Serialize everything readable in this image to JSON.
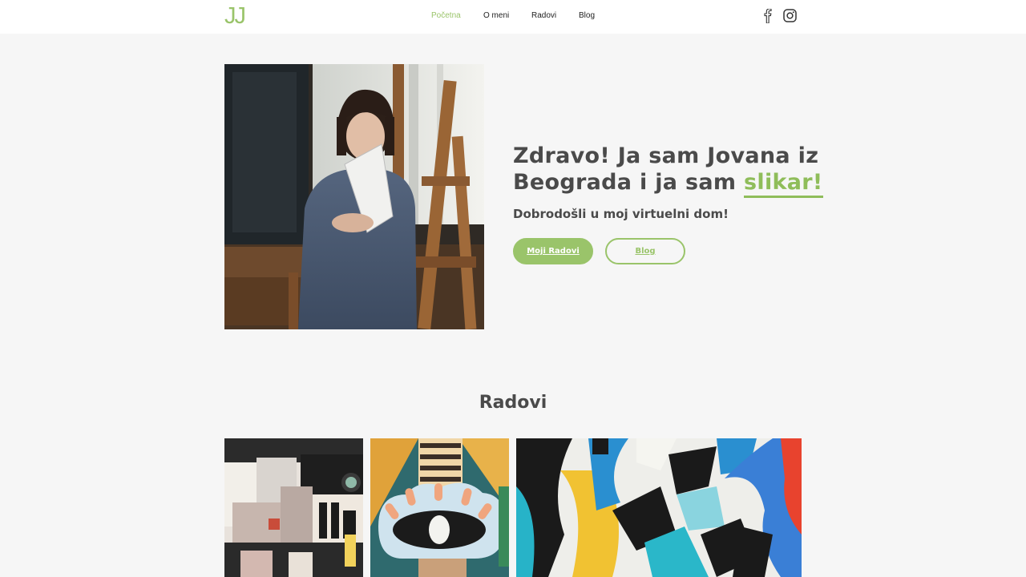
{
  "header": {
    "logo": "JJ",
    "nav": [
      {
        "label": "Početna",
        "active": true
      },
      {
        "label": "O meni",
        "active": false
      },
      {
        "label": "Radovi",
        "active": false
      },
      {
        "label": "Blog",
        "active": false
      }
    ],
    "social": [
      "facebook-icon",
      "instagram-icon"
    ]
  },
  "hero": {
    "headline_part1": "Zdravo! Ja sam Jovana iz Beograda i ja sam ",
    "headline_accent": "slikar!",
    "subtitle": "Dobrodošli u moj virtuelni dom!",
    "primary_button": "Moji Radovi",
    "secondary_button": "Blog"
  },
  "works": {
    "title": "Radovi"
  },
  "colors": {
    "accent": "#9ac46a",
    "text": "#4a4a4a",
    "background": "#f6f6f6"
  }
}
